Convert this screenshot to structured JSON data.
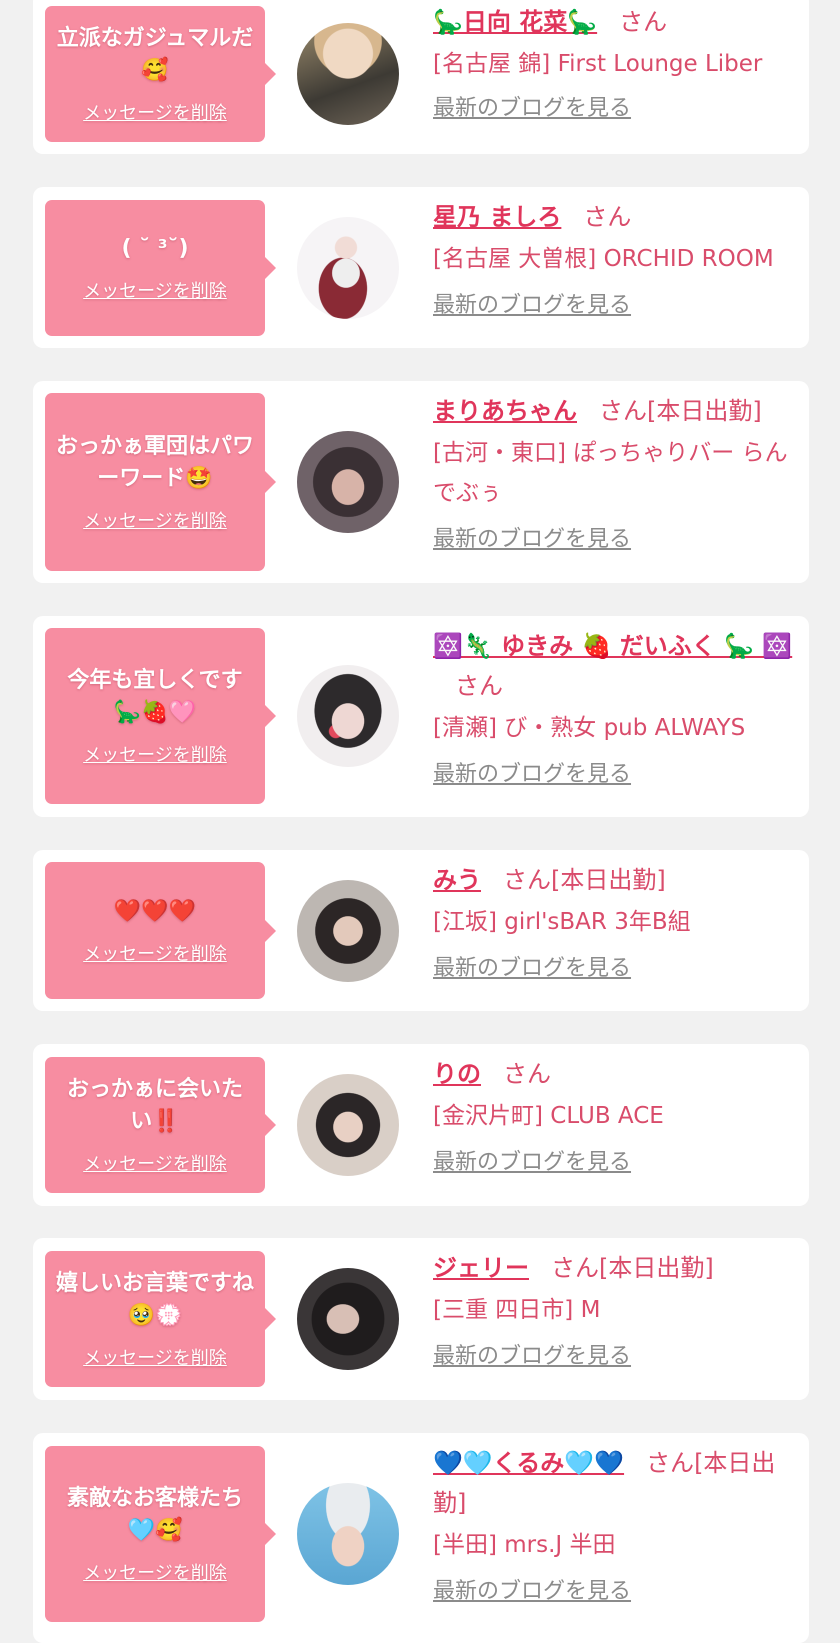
{
  "delete_label": "メッセージを削除",
  "blog_label": "最新のブログを見る",
  "honorific": "さん",
  "colors": {
    "page_bg": "#f1f1f1",
    "card_bg": "#ffffff",
    "bubble_bg": "#f78da1",
    "name": "#e0355b",
    "shop": "#d94c6b",
    "blog_link": "#8b8b8b"
  },
  "messages": [
    {
      "bubble_text": "立派なガジュマルだ🥰",
      "name": "🦕日向 花菜🦕",
      "status": "",
      "shop": "[名古屋 錦] First Lounge Liber",
      "avatar_icon": "profile-photo"
    },
    {
      "bubble_text": "( ˘ ³˘)",
      "name": "星乃 ましろ",
      "status": "",
      "shop": "[名古屋 大曽根] ORCHID ROOM",
      "avatar_icon": "profile-photo"
    },
    {
      "bubble_text": "おっかぁ軍団はパワーワード🤩",
      "name": "まりあちゃん",
      "status": "[本日出勤]",
      "shop": "[古河・東口] ぽっちゃりバー らんでぶぅ",
      "avatar_icon": "profile-photo"
    },
    {
      "bubble_text": "今年も宜しくです🦕🍓🩷",
      "name": "🔯🦎 ゆきみ 🍓 だいふく 🦕 🔯",
      "status": "",
      "shop": "[清瀬] び・熟女 pub ALWAYS",
      "avatar_icon": "profile-photo"
    },
    {
      "bubble_text": "❤️❤️❤️",
      "name": "みう",
      "status": "[本日出勤]",
      "shop": "[江坂] girl'sBAR 3年B組",
      "avatar_icon": "profile-photo"
    },
    {
      "bubble_text": "おっかぁに会いたい‼️",
      "name": "りの",
      "status": "",
      "shop": "[金沢片町] CLUB ACE",
      "avatar_icon": "profile-photo"
    },
    {
      "bubble_text": "嬉しいお言葉ですね🥹💮",
      "name": "ジェリー",
      "status": "[本日出勤]",
      "shop": "[三重 四日市] M",
      "avatar_icon": "profile-photo"
    },
    {
      "bubble_text": "素敵なお客様たち🩵🥰",
      "name": "💙🩵くるみ🩵💙",
      "status": "[本日出勤]",
      "shop": "[半田] mrs.J 半田",
      "avatar_icon": "profile-photo"
    }
  ]
}
